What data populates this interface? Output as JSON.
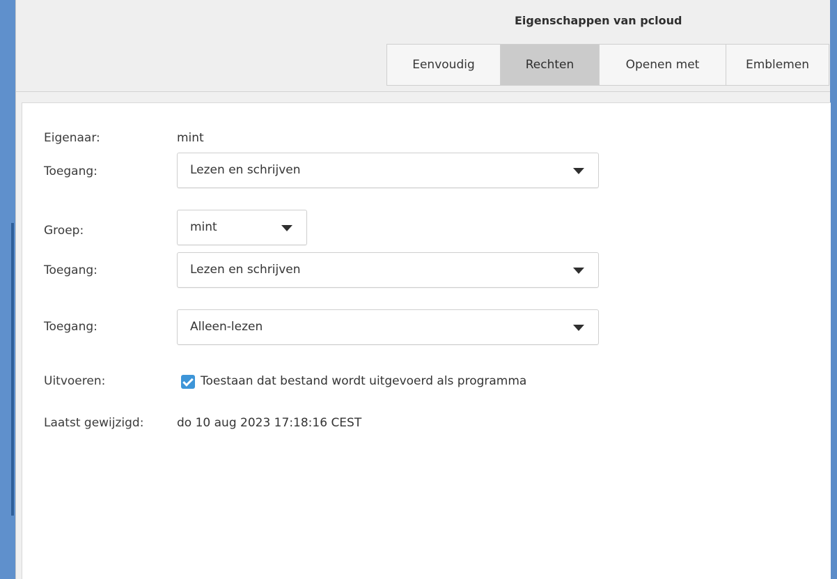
{
  "dialog": {
    "title": "Eigenschappen van pcloud"
  },
  "tabs": [
    {
      "label": "Eenvoudig",
      "active": false
    },
    {
      "label": "Rechten",
      "active": true
    },
    {
      "label": "Openen met",
      "active": false
    },
    {
      "label": "Emblemen",
      "active": false
    }
  ],
  "permissions": {
    "owner_label": "Eigenaar:",
    "owner_value": "mint",
    "owner_access_label": "Toegang:",
    "owner_access_value": "Lezen en schrijven",
    "group_label": "Groep:",
    "group_value": "mint",
    "group_access_label": "Toegang:",
    "group_access_value": "Lezen en schrijven",
    "other_access_label": "Toegang:",
    "other_access_value": "Alleen-lezen",
    "execute_label": "Uitvoeren:",
    "execute_checkbox_label": "Toestaan dat bestand wordt uitgevoerd als programma",
    "execute_checked": true,
    "modified_label": "Laatst gewijzigd:",
    "modified_value": "do 10 aug 2023 17:18:16 CEST"
  },
  "colors": {
    "accent": "#3d95d8",
    "active_tab": "#cbcbcb",
    "desktop_background": "#5b8cc8"
  }
}
